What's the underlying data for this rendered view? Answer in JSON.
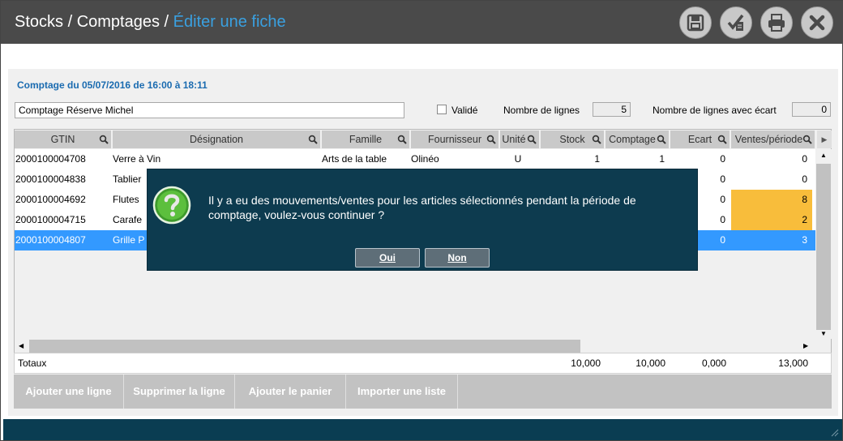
{
  "breadcrumb": {
    "part1": "Stocks",
    "sep1": " / ",
    "part2": "Comptages",
    "sep2": " / ",
    "current": "Éditer une fiche"
  },
  "toolbar_icons": [
    "save-icon",
    "validate-icon",
    "print-icon",
    "close-icon"
  ],
  "form": {
    "heading": "Comptage du 05/07/2016 de 16:00 à 18:11",
    "name_value": "Comptage Réserve Michel",
    "validated_label": "Validé",
    "validated_checked": false,
    "lines_label": "Nombre de lignes",
    "lines_value": "5",
    "diff_label": "Nombre de lignes avec écart",
    "diff_value": "0"
  },
  "table": {
    "columns": [
      "GTIN",
      "Désignation",
      "Famille",
      "Fournisseur",
      "Unité",
      "Stock",
      "Comptage",
      "Ecart",
      "Ventes/période"
    ],
    "rows": [
      {
        "gtin": "2000100004708",
        "designation": "Verre à Vin",
        "famille": "Arts de la table",
        "fournisseur": "Olinéo",
        "unite": "U",
        "stock": "1",
        "comptage": "1",
        "ecart": "0",
        "ventes": "0",
        "highlight": false,
        "selected": false
      },
      {
        "gtin": "2000100004838",
        "designation": "Tablier",
        "famille": "",
        "fournisseur": "",
        "unite": "",
        "stock": "",
        "comptage": "",
        "ecart": "0",
        "ventes": "0",
        "highlight": false,
        "selected": false
      },
      {
        "gtin": "2000100004692",
        "designation": "Flutes",
        "famille": "",
        "fournisseur": "",
        "unite": "",
        "stock": "",
        "comptage": "",
        "ecart": "0",
        "ventes": "8",
        "highlight": true,
        "selected": false
      },
      {
        "gtin": "2000100004715",
        "designation": "Carafe",
        "famille": "",
        "fournisseur": "",
        "unite": "",
        "stock": "",
        "comptage": "",
        "ecart": "0",
        "ventes": "2",
        "highlight": true,
        "selected": false
      },
      {
        "gtin": "2000100004807",
        "designation": "Grille P",
        "famille": "",
        "fournisseur": "",
        "unite": "",
        "stock": "",
        "comptage": "",
        "ecart": "0",
        "ventes": "3",
        "highlight": false,
        "selected": true
      }
    ]
  },
  "totals": {
    "label": "Totaux",
    "stock": "10,000",
    "comptage": "10,000",
    "ecart": "0,000",
    "ventes": "13,000"
  },
  "actions": [
    "Ajouter une ligne",
    "Supprimer la ligne",
    "Ajouter le panier",
    "Importer une liste"
  ],
  "dialog": {
    "message": "Il y a eu des mouvements/ventes pour les articles sélectionnés pendant la période de comptage, voulez-vous continuer ?",
    "yes": "Oui",
    "no": "Non",
    "icon": "question-icon"
  },
  "colors": {
    "titlebar": "#4a4a4a",
    "accent": "#3aa0e0",
    "dialog": "#0d3b4f",
    "selected_row": "#3399ff",
    "highlight": "#f8bd3b",
    "footer": "#0a3d52"
  }
}
